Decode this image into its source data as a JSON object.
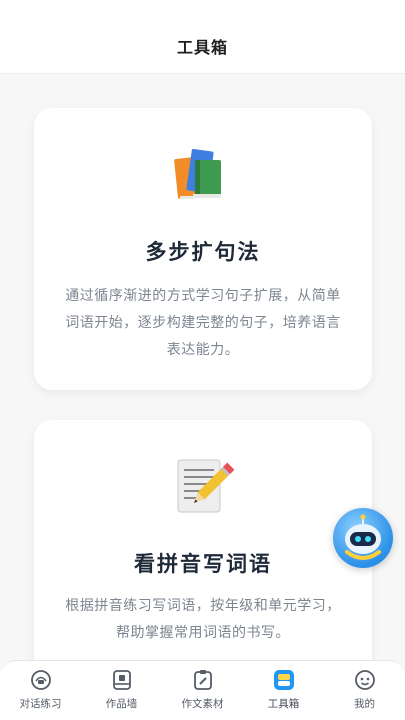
{
  "header": {
    "title": "工具箱"
  },
  "cards": [
    {
      "icon": "books-icon",
      "title": "多步扩句法",
      "description": "通过循序渐进的方式学习句子扩展，从简单词语开始，逐步构建完整的句子，培养语言表达能力。"
    },
    {
      "icon": "pencil-notepad-icon",
      "title": "看拼音写词语",
      "description": "根据拼音练习写词语，按年级和单元学习，帮助掌握常用词语的书写。"
    }
  ],
  "assistant": {
    "icon": "robot-assistant-icon"
  },
  "tabbar": {
    "active_index": 3,
    "active_color": "#2196f3",
    "items": [
      {
        "label": "对话练习",
        "icon": "chat-practice-icon"
      },
      {
        "label": "作品墙",
        "icon": "works-wall-icon"
      },
      {
        "label": "作文素材",
        "icon": "composition-material-icon"
      },
      {
        "label": "工具箱",
        "icon": "toolbox-icon"
      },
      {
        "label": "我的",
        "icon": "profile-icon"
      }
    ]
  }
}
